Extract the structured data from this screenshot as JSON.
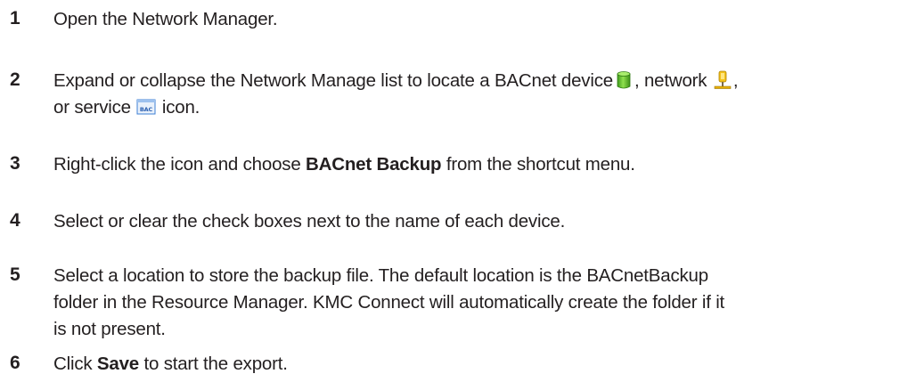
{
  "steps": [
    {
      "number": "1",
      "text": "Open the Network Manager."
    },
    {
      "number": "2",
      "line1_before_device": "Expand or collapse the Network Manage list to locate a BACnet device",
      "line1_after_device": ", network",
      "line1_end": ",",
      "line2_before_service": "or service",
      "line2_after_service": "icon.",
      "icons": [
        "database-icon",
        "network-icon",
        "bac-service-icon"
      ],
      "service_icon_label": "BAC"
    },
    {
      "number": "3",
      "before": "Right-click the icon and choose ",
      "bold": "BACnet Backup",
      "after": " from the shortcut menu."
    },
    {
      "number": "4",
      "text": "Select or clear the check boxes next to the name of each device."
    },
    {
      "number": "5",
      "line1": "Select a location to store the backup file. The default location is the BACnetBackup",
      "line2": "folder in the Resource Manager. KMC Connect will automatically create the folder if it",
      "line3": "is not present."
    },
    {
      "number": "6",
      "before": "Click ",
      "bold": "Save",
      "after": " to start the export."
    }
  ],
  "colors": {
    "text": "#231f20",
    "device_green": "#5cb82e",
    "network_yellow": "#e8b000",
    "service_blue": "#3d7fd6"
  }
}
